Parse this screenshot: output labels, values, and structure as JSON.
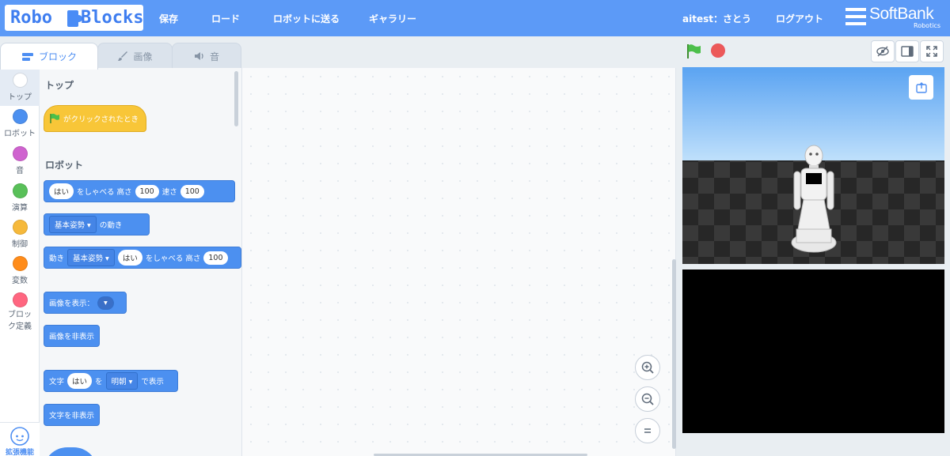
{
  "header": {
    "logo_left": "Robo",
    "logo_right": "Blocks",
    "menu": [
      "保存",
      "ロード",
      "ロボットに送る",
      "ギャラリー"
    ],
    "user": "aitest：さとう",
    "logout": "ログアウト",
    "brand": "SoftBank",
    "brand_sub": "Robotics"
  },
  "tabs": [
    {
      "label": "ブロック",
      "icon": "blocks-icon",
      "active": true
    },
    {
      "label": "画像",
      "icon": "brush-icon",
      "active": false
    },
    {
      "label": "音",
      "icon": "speaker-icon",
      "active": false
    }
  ],
  "categories": [
    {
      "label": "トップ",
      "color": "#ffffff"
    },
    {
      "label": "ロボット",
      "color": "#4c90f0"
    },
    {
      "label": "音",
      "color": "#cf63cf"
    },
    {
      "label": "演算",
      "color": "#59c059"
    },
    {
      "label": "制御",
      "color": "#f6b93b"
    },
    {
      "label": "変数",
      "color": "#ff8c1a"
    },
    {
      "label": "ブロック定義",
      "color": "#ff6680"
    }
  ],
  "extension": {
    "label": "拡張機能"
  },
  "palette": {
    "section_top": "トップ",
    "flag_block": "がクリックされたとき",
    "section_robot": "ロボット",
    "speak": {
      "text": "はい",
      "mid": "をしゃべる 高さ",
      "pitch": "100",
      "speed_label": "速さ",
      "speed": "100"
    },
    "motion": {
      "pose": "基本姿勢",
      "suffix": "の動き"
    },
    "motion_speak": {
      "prefix": "動き",
      "pose": "基本姿勢",
      "text": "はい",
      "mid": "をしゃべる 高さ",
      "pitch": "100"
    },
    "show_image": {
      "label": "画像を表示："
    },
    "hide_image": "画像を非表示",
    "show_text": {
      "prefix": "文字",
      "text": "はい",
      "wo": "を",
      "font": "明朝",
      "suffix": "で表示"
    },
    "hide_text": "文字を非表示"
  },
  "colors": {
    "header": "#5c9af7",
    "robot_block": "#4c90f0",
    "event_block": "#f8c638"
  }
}
